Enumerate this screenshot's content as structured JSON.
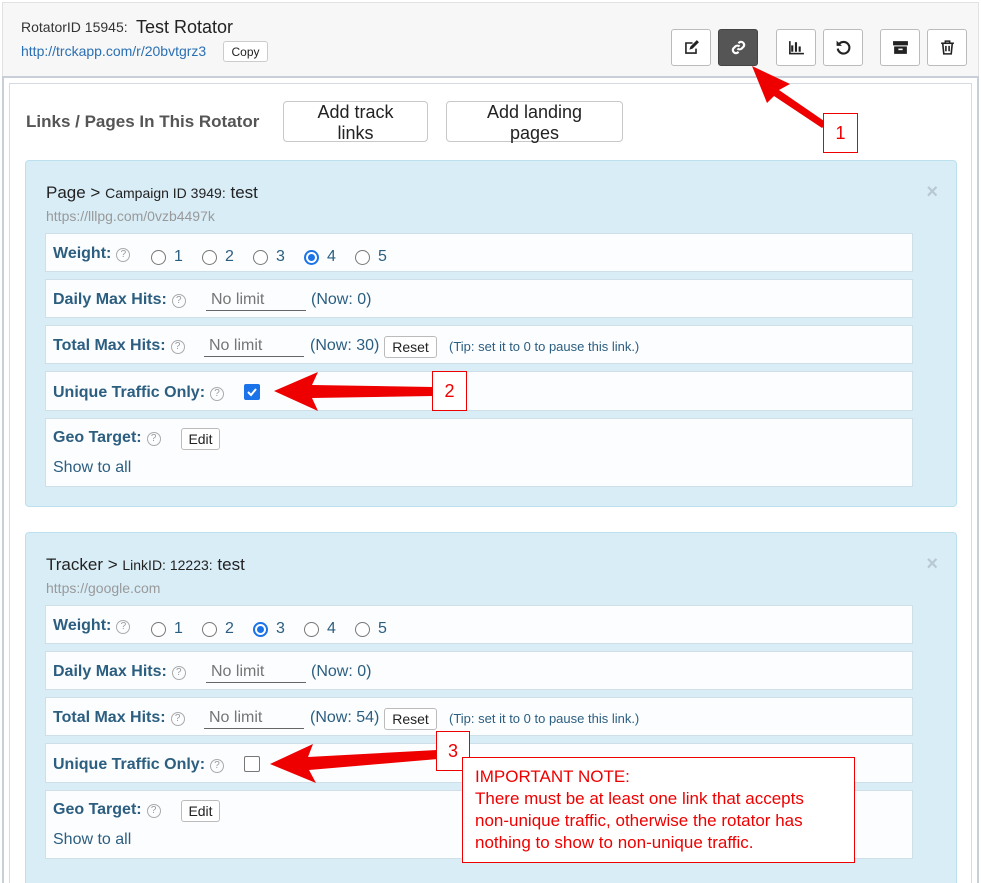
{
  "header": {
    "rotator_id_label": "RotatorID 15945:",
    "rotator_title": "Test Rotator",
    "rotator_url": "http://trckapp.com/r/20bvtgrz3",
    "copy_label": "Copy",
    "toolbar_icons": [
      "edit-icon",
      "link-icon",
      "chart-icon",
      "undo-icon",
      "archive-icon",
      "trash-icon"
    ]
  },
  "main": {
    "section_title": "Links / Pages In This Rotator",
    "add_track_links_label": "Add track links",
    "add_landing_pages_label": "Add landing pages"
  },
  "cards": [
    {
      "kind": "Page >",
      "sub": "Campaign ID 3949:",
      "name": "test",
      "url": "https://lllpg.com/0vzb4497k",
      "close": "×",
      "weight_label": "Weight:",
      "weight_options": [
        "1",
        "2",
        "3",
        "4",
        "5"
      ],
      "weight_selected": "4",
      "daily_label": "Daily Max Hits:",
      "daily_placeholder": "No limit",
      "daily_now": "(Now: 0)",
      "total_label": "Total Max Hits:",
      "total_placeholder": "No limit",
      "total_now": "(Now: 30)",
      "reset_label": "Reset",
      "tip": "(Tip: set it to 0 to pause this link.)",
      "unique_label": "Unique Traffic Only:",
      "unique_checked": true,
      "geo_label": "Geo Target:",
      "edit_label": "Edit",
      "show_all": "Show to all"
    },
    {
      "kind": "Tracker >",
      "sub": "LinkID: 12223:",
      "name": "test",
      "url": "https://google.com",
      "close": "×",
      "weight_label": "Weight:",
      "weight_options": [
        "1",
        "2",
        "3",
        "4",
        "5"
      ],
      "weight_selected": "3",
      "daily_label": "Daily Max Hits:",
      "daily_placeholder": "No limit",
      "daily_now": "(Now: 0)",
      "total_label": "Total Max Hits:",
      "total_placeholder": "No limit",
      "total_now": "(Now: 54)",
      "reset_label": "Reset",
      "tip": "(Tip: set it to 0 to pause this link.)",
      "unique_label": "Unique Traffic Only:",
      "unique_checked": false,
      "geo_label": "Geo Target:",
      "edit_label": "Edit",
      "show_all": "Show to all"
    }
  ],
  "annotations": {
    "callout_1": "1",
    "callout_2": "2",
    "callout_3": "3",
    "note_lines": [
      "IMPORTANT NOTE:",
      "There must be at least one link that accepts",
      "non-unique traffic, otherwise the rotator has",
      "nothing to show to non-unique traffic."
    ],
    "color": "#ee0000"
  },
  "colors": {
    "card_bg": "#d9edf7",
    "label_blue": "#2c5e80",
    "accent": "#1a73e8"
  }
}
